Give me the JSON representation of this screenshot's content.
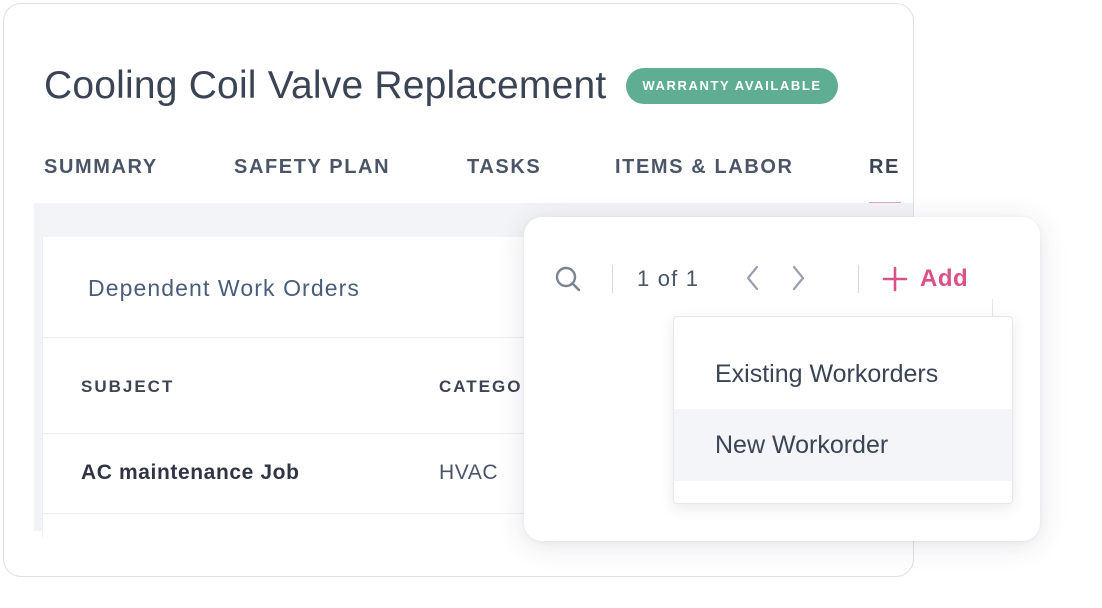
{
  "work_order": {
    "title": "Cooling Coil Valve Replacement",
    "badge": "WARRANTY AVAILABLE"
  },
  "tabs": [
    {
      "label": "SUMMARY"
    },
    {
      "label": "SAFETY PLAN"
    },
    {
      "label": "TASKS"
    },
    {
      "label": "ITEMS & LABOR"
    },
    {
      "label": "RE",
      "active": true
    }
  ],
  "dependent_panel": {
    "title": "Dependent Work Orders",
    "columns": [
      "SUBJECT",
      "CATEGO"
    ],
    "rows": [
      {
        "subject": "AC maintenance Job",
        "category": "HVAC"
      }
    ]
  },
  "toolbar": {
    "search_icon": "search-icon",
    "pager_text": "1 of 1",
    "prev_icon": "chevron-left-icon",
    "next_icon": "chevron-right-icon",
    "add_icon": "plus-icon",
    "add_label": "Add"
  },
  "add_menu": {
    "items": [
      {
        "label": "Existing Workorders"
      },
      {
        "label": "New Workorder",
        "highlighted": true
      }
    ]
  },
  "colors": {
    "badge": "#5fae93",
    "accent": "#d9508a",
    "title_text": "#3a4454",
    "section_title": "#4a5d7b"
  }
}
